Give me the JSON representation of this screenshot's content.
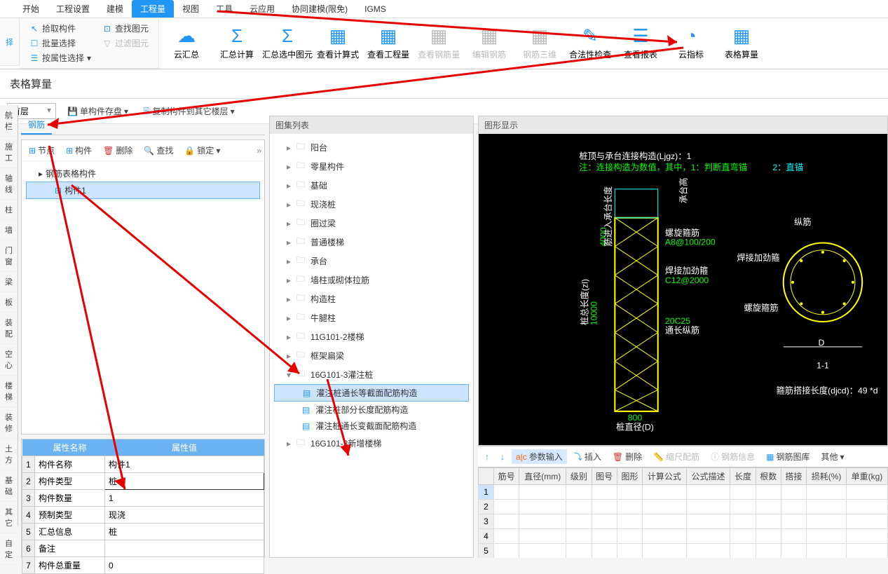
{
  "ribbon_tabs": [
    "开始",
    "工程设置",
    "建模",
    "工程量",
    "视图",
    "工具",
    "云应用",
    "协同建模(限免)",
    "IGMS"
  ],
  "active_tab": "工程量",
  "qat": {
    "col1": [
      "拾取构件",
      "批量选择",
      "按属性选择"
    ],
    "col2": [
      "查找图元",
      "过滤图元"
    ]
  },
  "ribbon_buttons": [
    {
      "label": "云汇总",
      "enabled": true,
      "icon": "☁"
    },
    {
      "label": "汇总计算",
      "enabled": true,
      "icon": "Σ"
    },
    {
      "label": "汇总选中图元",
      "enabled": true,
      "icon": "Σ"
    },
    {
      "label": "查看计算式",
      "enabled": true,
      "icon": "▦"
    },
    {
      "label": "查看工程量",
      "enabled": true,
      "icon": "▦"
    },
    {
      "label": "查看钢筋量",
      "enabled": false,
      "icon": "▦"
    },
    {
      "label": "编辑钢筋",
      "enabled": false,
      "icon": "▦"
    },
    {
      "label": "钢筋三维",
      "enabled": false,
      "icon": "▦"
    },
    {
      "label": "合法性检查",
      "enabled": true,
      "icon": "✎"
    },
    {
      "label": "查看报表",
      "enabled": true,
      "icon": "☰"
    },
    {
      "label": "云指标",
      "enabled": true,
      "icon": "◔"
    },
    {
      "label": "表格算量",
      "enabled": true,
      "icon": "▦"
    }
  ],
  "panel_title": "表格算量",
  "toolbar_row": {
    "floor": "首层",
    "btn1": "单构件存盘",
    "btn2": "复制构件到其它楼层"
  },
  "left_categories": [
    "航栏",
    "施工",
    "轴线",
    "柱",
    "墙",
    "门窗",
    "梁",
    "板",
    "装配",
    "空心",
    "楼梯",
    "装修",
    "土方",
    "基础",
    "其它",
    "自定"
  ],
  "left_tab": "钢筋",
  "tree_toolbar": [
    "节点",
    "构件",
    "删除",
    "查找",
    "锁定"
  ],
  "component_tree": {
    "root": "钢筋表格构件",
    "child": "构件1"
  },
  "props_headers": [
    "属性名称",
    "属性值"
  ],
  "props": [
    {
      "n": "1",
      "name": "构件名称",
      "val": "构件1"
    },
    {
      "n": "2",
      "name": "构件类型",
      "val": "桩"
    },
    {
      "n": "3",
      "name": "构件数量",
      "val": "1"
    },
    {
      "n": "4",
      "name": "预制类型",
      "val": "现浇"
    },
    {
      "n": "5",
      "name": "汇总信息",
      "val": "桩"
    },
    {
      "n": "6",
      "name": "备注",
      "val": ""
    },
    {
      "n": "7",
      "name": "构件总重量",
      "val": "0"
    }
  ],
  "mid_title": "图集列表",
  "mid_tree": [
    {
      "label": "阳台",
      "type": "folder"
    },
    {
      "label": "零星构件",
      "type": "folder"
    },
    {
      "label": "基础",
      "type": "folder"
    },
    {
      "label": "现浇桩",
      "type": "folder"
    },
    {
      "label": "圈过梁",
      "type": "folder"
    },
    {
      "label": "普通楼梯",
      "type": "folder"
    },
    {
      "label": "承台",
      "type": "folder"
    },
    {
      "label": "墙柱或砌体拉筋",
      "type": "folder"
    },
    {
      "label": "构造柱",
      "type": "folder"
    },
    {
      "label": "牛腿柱",
      "type": "folder"
    },
    {
      "label": "11G101-2楼梯",
      "type": "folder"
    },
    {
      "label": "框架扁梁",
      "type": "folder"
    },
    {
      "label": "16G101-3灌注桩",
      "type": "folder",
      "expanded": true,
      "children": [
        {
          "label": "灌注桩通长等截面配筋构造",
          "selected": true
        },
        {
          "label": "灌注桩部分长度配筋构造"
        },
        {
          "label": "灌注桩通长变截面配筋构造"
        }
      ]
    },
    {
      "label": "16G101-3新增楼梯",
      "type": "folder"
    }
  ],
  "right_title": "图形显示",
  "diagram": {
    "line1": "桩顶与承台连接构造(Ljgz)：1",
    "line2_a": "注：连接构造为数值，其中，1：判断直弯锚",
    "line2_b": "2：直锚",
    "labels": {
      "luoxuan": "螺旋箍筋",
      "a8": "A8@100/200",
      "hanjie": "焊接加劲箍",
      "c12": "C12@2000",
      "tc": "20C25",
      "tongchang": "通长纵筋",
      "zhijing": "桩直径(D)",
      "width": "800",
      "height": "10000",
      "height2": "4000",
      "zhuanglength": "桩总长度(zl)",
      "jinru": "筋进入承台长度",
      "chengtai": "承台高",
      "zongjin": "纵筋",
      "hanjie2": "焊接加劲箍",
      "luoxuan2": "螺旋箍筋",
      "D": "D",
      "section": "1-1",
      "dajie": "箍筋搭接长度(djcd)：49 *d"
    }
  },
  "grid_toolbar": [
    "参数输入",
    "插入",
    "删除",
    "缩尺配筋",
    "钢筋信息",
    "钢筋图库",
    "其他"
  ],
  "grid_headers": [
    "筋号",
    "直径(mm)",
    "级别",
    "图号",
    "图形",
    "计算公式",
    "公式描述",
    "长度",
    "根数",
    "搭接",
    "损耗(%)",
    "单重(kg)"
  ],
  "grid_rows": [
    "1",
    "2",
    "3",
    "4",
    "5"
  ]
}
